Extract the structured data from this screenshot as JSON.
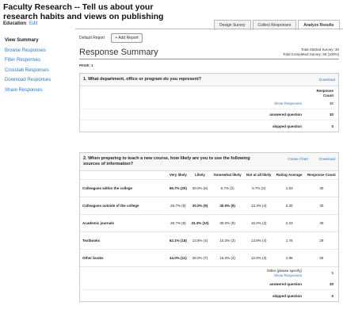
{
  "survey": {
    "title": "Faculty Research -- Tell us about your research habits and views on publishing",
    "org": "Education",
    "edit_label": "Edit"
  },
  "tabs": [
    {
      "label": "Design Survey"
    },
    {
      "label": "Collect Responses"
    },
    {
      "label": "Analyze Results"
    }
  ],
  "sidebar": {
    "items": [
      {
        "label": "View Summary"
      },
      {
        "label": "Browse Responses"
      },
      {
        "label": "Filter Responses"
      },
      {
        "label": "Crosstab Responses"
      },
      {
        "label": "Download Responses"
      },
      {
        "label": "Share Responses"
      }
    ]
  },
  "report": {
    "label": "Default Report",
    "add_button": "+ Add Report"
  },
  "summary": {
    "title": "Response Summary",
    "total_started": "Total Started Survey: 30",
    "total_completed": "Total Completed Survey: 30  (100%)",
    "page": "PAGE: 1"
  },
  "q1": {
    "text": "1. What department, office or program do you represent?",
    "download": "Download",
    "col_header_1": "Response",
    "col_header_2": "Count",
    "show_responses": "Show Responses",
    "show_count": "30",
    "answered_label": "answered question",
    "answered_value": "30",
    "skipped_label": "skipped question",
    "skipped_value": "0"
  },
  "q2": {
    "text": "2. When preparing to teach a new course, how likely are you to use the following sources of information?",
    "create_chart": "Create Chart",
    "download": "Download",
    "headers": [
      "Very likely",
      "Likely",
      "Somewhat likely",
      "Not at all likely",
      "Rating Average",
      "Response Count"
    ],
    "rows": [
      {
        "label": "Colleagues within the college",
        "cells": [
          "66.7% (20)",
          "20.0% (6)",
          "6.7% (2)",
          "6.7% (2)",
          "1.53",
          "30"
        ]
      },
      {
        "label": "Colleagues outside of the college",
        "cells": [
          "26.7% (8)",
          "30.0% (9)",
          "30.0% (9)",
          "13.3% (4)",
          "2.30",
          "30"
        ]
      },
      {
        "label": "Academic journals",
        "cells": [
          "26.7% (8)",
          "33.3% (10)",
          "30.0% (9)",
          "10.0% (3)",
          "2.23",
          "30"
        ]
      },
      {
        "label": "Textbooks",
        "cells": [
          "62.1% (18)",
          "13.8% (4)",
          "10.3% (3)",
          "13.8% (4)",
          "1.76",
          "29"
        ]
      },
      {
        "label": "Other books",
        "cells": [
          "44.0% (11)",
          "28.0% (7)",
          "16.0% (4)",
          "12.0% (3)",
          "1.96",
          "25"
        ]
      }
    ],
    "other_label": "Other (please specify)",
    "other_show": "Show Responses",
    "other_value": "5",
    "answered_label": "answered question",
    "answered_value": "30",
    "skipped_label": "skipped question",
    "skipped_value": "0"
  }
}
